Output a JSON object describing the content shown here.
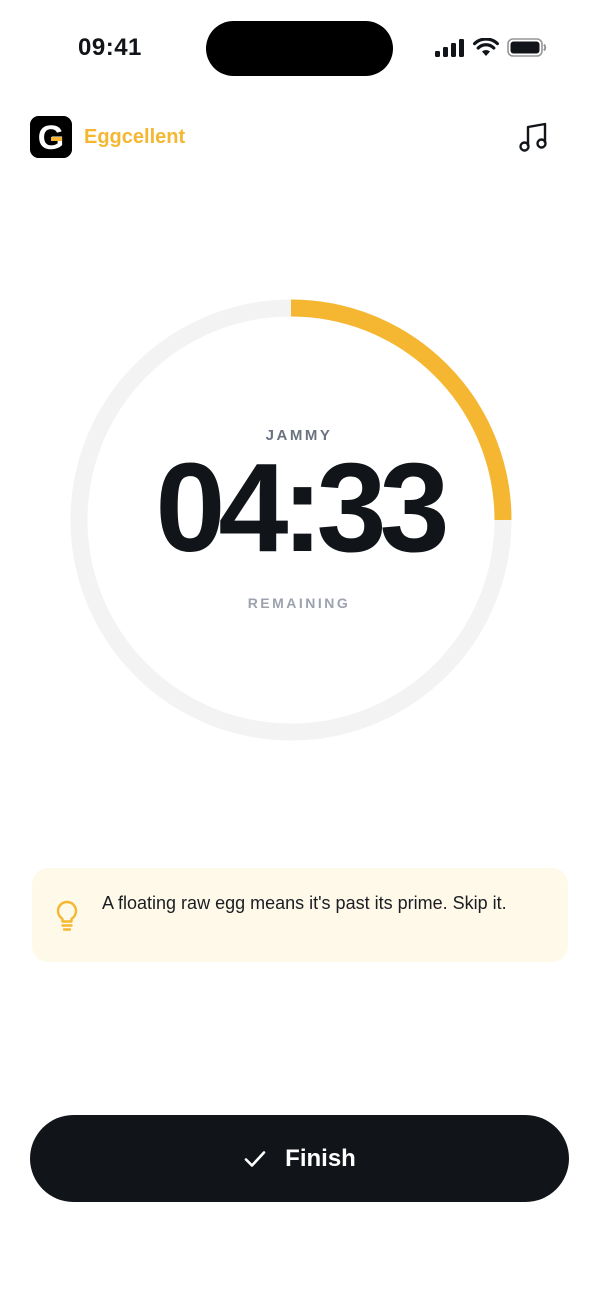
{
  "status_bar": {
    "time": "09:41",
    "icons": [
      "cellular-signal-icon",
      "wifi-icon",
      "battery-icon"
    ]
  },
  "header": {
    "logo_letter": "G",
    "brand_name": "Eggcellent",
    "music_icon": "music-note-icon"
  },
  "timer": {
    "mode": "JAMMY",
    "time_remaining": "04:33",
    "remaining_label": "REMAINING",
    "progress_fraction": 0.25
  },
  "tip": {
    "icon": "lightbulb-icon",
    "text": "A floating raw egg means it's past its prime. Skip it."
  },
  "finish_button": {
    "icon": "check-icon",
    "label": "Finish"
  },
  "colors": {
    "accent": "#F5B731",
    "dark": "#111418",
    "track": "#F3F3F3",
    "tip_background": "#FFF9EA"
  }
}
